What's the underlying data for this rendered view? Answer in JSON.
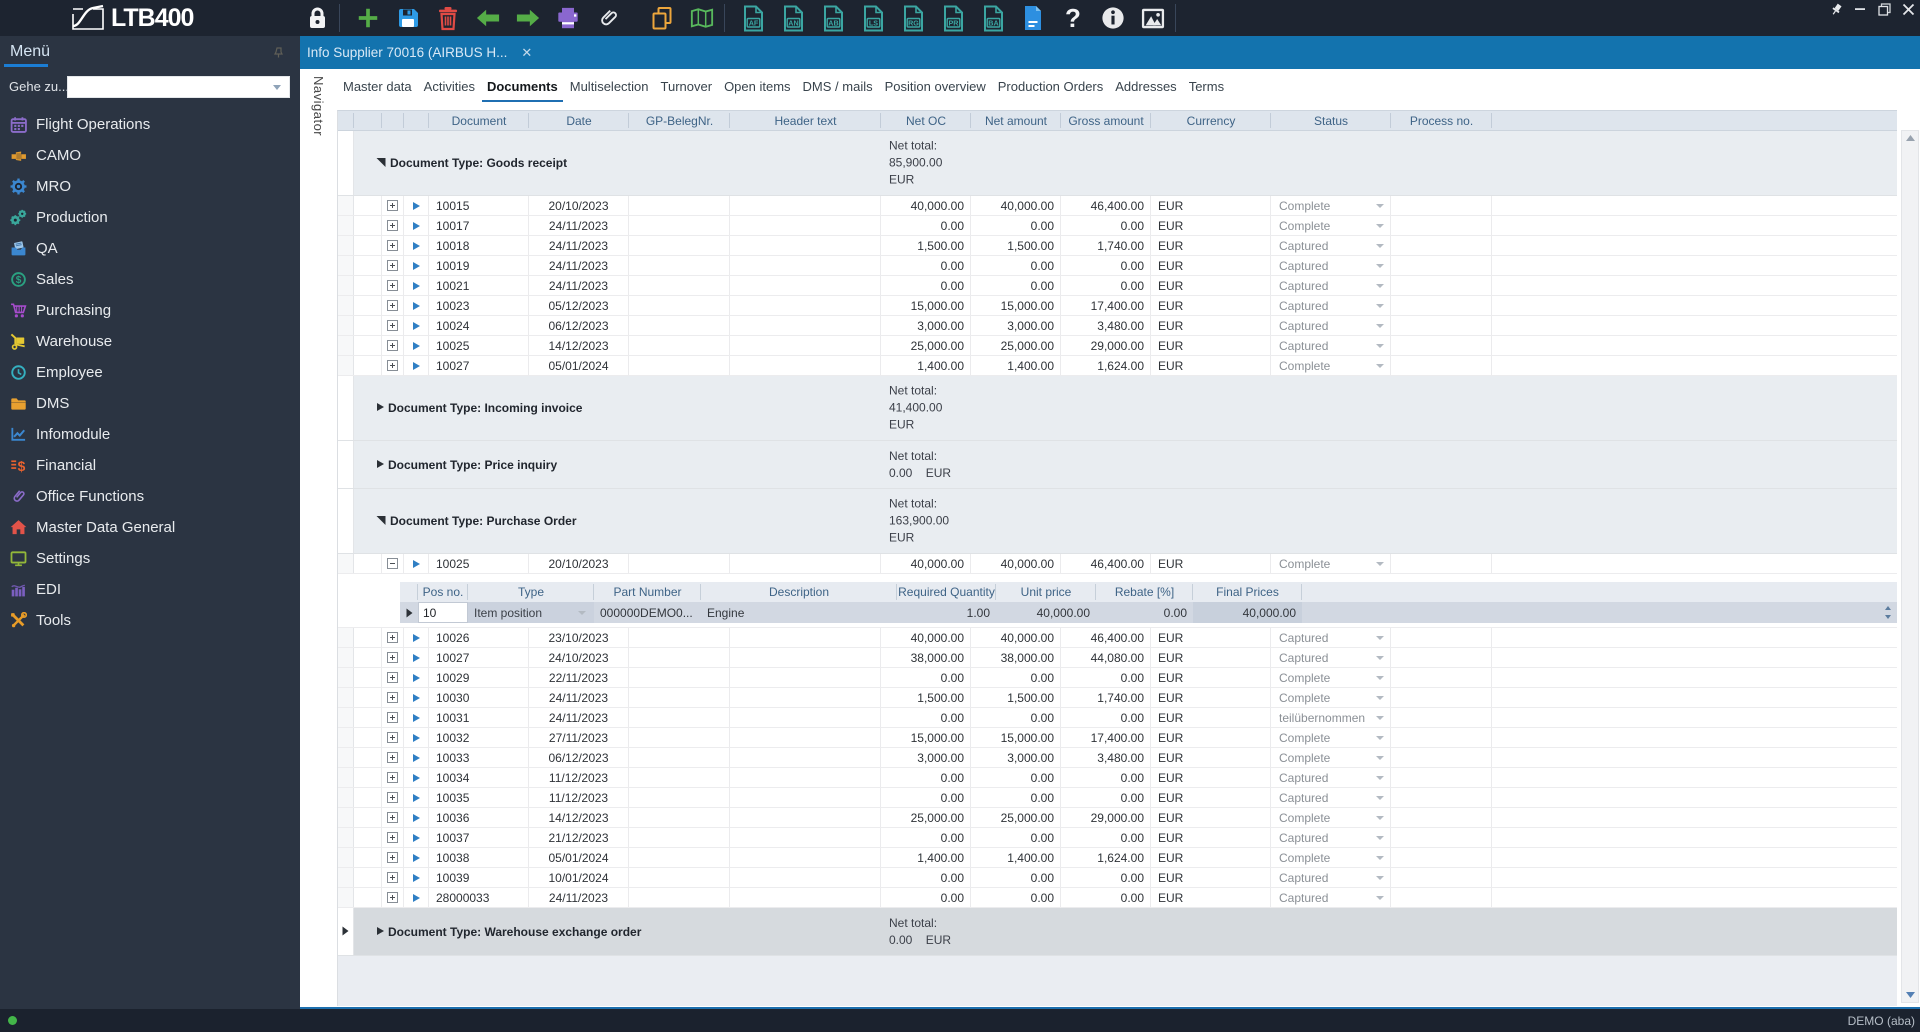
{
  "app": {
    "logo": "LTB400"
  },
  "topbar": {
    "tools": [
      {
        "name": "lock",
        "color": "#f2f3f5"
      },
      {
        "name": "separator"
      },
      {
        "name": "new",
        "color": "#55ad47"
      },
      {
        "name": "save",
        "color": "#2e9be6"
      },
      {
        "name": "delete",
        "color": "#e04b45"
      },
      {
        "name": "back",
        "color": "#55ad47"
      },
      {
        "name": "forward",
        "color": "#55ad47"
      },
      {
        "name": "print",
        "color": "#8a67cf"
      },
      {
        "name": "attachment",
        "color": "#e8eaed"
      },
      {
        "name": "copy",
        "color": "#edA63c"
      },
      {
        "name": "map",
        "color": "#58b85c"
      },
      {
        "name": "separator"
      },
      {
        "name": "doc-letter",
        "letters": "AF",
        "color": "#3ba6a2"
      },
      {
        "name": "doc-letter",
        "letters": "AN",
        "color": "#3ba6a2"
      },
      {
        "name": "doc-letter",
        "letters": "AB",
        "color": "#3ba6a2"
      },
      {
        "name": "doc-letter",
        "letters": "LS",
        "color": "#3ba6a2"
      },
      {
        "name": "doc-letter",
        "letters": "RG",
        "color": "#3ba6a2"
      },
      {
        "name": "doc-letter",
        "letters": "PR",
        "color": "#3ba6a2"
      },
      {
        "name": "doc-letter",
        "letters": "BA",
        "color": "#3ba6a2"
      },
      {
        "name": "doc-blue",
        "color": "#2d8fe0"
      },
      {
        "name": "help",
        "color": "#f2f3f5"
      },
      {
        "name": "info",
        "color": "#e9eaec"
      },
      {
        "name": "image",
        "color": "#e9eaec"
      },
      {
        "name": "separator"
      }
    ],
    "window_buttons": [
      "pin",
      "minimize",
      "restore",
      "close"
    ]
  },
  "sidebar": {
    "title": "Menü",
    "goto_label": "Gehe zu...",
    "goto_value": "",
    "items": [
      {
        "label": "Flight Operations",
        "icon": "calendar",
        "color": "#8b6cc9"
      },
      {
        "label": "CAMO",
        "icon": "camo-tool",
        "color": "#e09a2f"
      },
      {
        "label": "MRO",
        "icon": "gear",
        "color": "#3b87d0"
      },
      {
        "label": "Production",
        "icon": "gears",
        "color": "#3aa79b"
      },
      {
        "label": "QA",
        "icon": "archive",
        "color": "#3b87d0"
      },
      {
        "label": "Sales",
        "icon": "dollar-circle",
        "color": "#2ba181"
      },
      {
        "label": "Purchasing",
        "icon": "cart",
        "color": "#a64ccc"
      },
      {
        "label": "Warehouse",
        "icon": "handtruck",
        "color": "#e5c832"
      },
      {
        "label": "Employee",
        "icon": "clock",
        "color": "#35b0c0"
      },
      {
        "label": "DMS",
        "icon": "folder",
        "color": "#e8a030"
      },
      {
        "label": "Infomodule",
        "icon": "chart-line",
        "color": "#3b87d0"
      },
      {
        "label": "Financial",
        "icon": "finance",
        "color": "#e8622f"
      },
      {
        "label": "Office Functions",
        "icon": "paperclip",
        "color": "#8b6cc9"
      },
      {
        "label": "Master Data General",
        "icon": "house",
        "color": "#e25349"
      },
      {
        "label": "Settings",
        "icon": "monitor",
        "color": "#92b73a"
      },
      {
        "label": "EDI",
        "icon": "chart-bars",
        "color": "#7b5fc0"
      },
      {
        "label": "Tools",
        "icon": "tools",
        "color": "#e89c28"
      }
    ]
  },
  "doc_tab": {
    "title": "Info Supplier 70016 (AIRBUS H...",
    "close_icon": "close"
  },
  "navigator_label": "Navigator",
  "page_tabs": {
    "selected": "Documents",
    "items": [
      "Master data",
      "Activities",
      "Documents",
      "Multiselection",
      "Turnover",
      "Open items",
      "DMS / mails",
      "Position overview",
      "Production Orders",
      "Addresses",
      "Terms"
    ]
  },
  "grid": {
    "columns": [
      "Document",
      "Date",
      "GP-BelegNr.",
      "Header text",
      "Net OC",
      "Net amount",
      "Gross amount",
      "Currency",
      "Status",
      "Process no."
    ],
    "groups": [
      {
        "label": "Document Type: Goods receipt",
        "expanded": true,
        "selected": false,
        "net_total_lines": [
          "Net total:",
          "85,900.00",
          "EUR"
        ],
        "rows": [
          {
            "document": "10015",
            "date": "20/10/2023",
            "gp_beleg": "",
            "header_text": "",
            "net_oc": "40,000.00",
            "net_amount": "40,000.00",
            "gross_amount": "46,400.00",
            "currency": "EUR",
            "status": "Complete",
            "process_no": ""
          },
          {
            "document": "10017",
            "date": "24/11/2023",
            "gp_beleg": "",
            "header_text": "",
            "net_oc": "0.00",
            "net_amount": "0.00",
            "gross_amount": "0.00",
            "currency": "EUR",
            "status": "Complete",
            "process_no": ""
          },
          {
            "document": "10018",
            "date": "24/11/2023",
            "gp_beleg": "",
            "header_text": "",
            "net_oc": "1,500.00",
            "net_amount": "1,500.00",
            "gross_amount": "1,740.00",
            "currency": "EUR",
            "status": "Captured",
            "process_no": ""
          },
          {
            "document": "10019",
            "date": "24/11/2023",
            "gp_beleg": "",
            "header_text": "",
            "net_oc": "0.00",
            "net_amount": "0.00",
            "gross_amount": "0.00",
            "currency": "EUR",
            "status": "Captured",
            "process_no": ""
          },
          {
            "document": "10021",
            "date": "24/11/2023",
            "gp_beleg": "",
            "header_text": "",
            "net_oc": "0.00",
            "net_amount": "0.00",
            "gross_amount": "0.00",
            "currency": "EUR",
            "status": "Captured",
            "process_no": ""
          },
          {
            "document": "10023",
            "date": "05/12/2023",
            "gp_beleg": "",
            "header_text": "",
            "net_oc": "15,000.00",
            "net_amount": "15,000.00",
            "gross_amount": "17,400.00",
            "currency": "EUR",
            "status": "Captured",
            "process_no": ""
          },
          {
            "document": "10024",
            "date": "06/12/2023",
            "gp_beleg": "",
            "header_text": "",
            "net_oc": "3,000.00",
            "net_amount": "3,000.00",
            "gross_amount": "3,480.00",
            "currency": "EUR",
            "status": "Captured",
            "process_no": ""
          },
          {
            "document": "10025",
            "date": "14/12/2023",
            "gp_beleg": "",
            "header_text": "",
            "net_oc": "25,000.00",
            "net_amount": "25,000.00",
            "gross_amount": "29,000.00",
            "currency": "EUR",
            "status": "Captured",
            "process_no": ""
          },
          {
            "document": "10027",
            "date": "05/01/2024",
            "gp_beleg": "",
            "header_text": "",
            "net_oc": "1,400.00",
            "net_amount": "1,400.00",
            "gross_amount": "1,624.00",
            "currency": "EUR",
            "status": "Complete",
            "process_no": ""
          }
        ]
      },
      {
        "label": "Document Type: Incoming invoice",
        "expanded": false,
        "selected": false,
        "net_total_lines": [
          "Net total:",
          "41,400.00",
          "EUR"
        ],
        "rows": []
      },
      {
        "label": "Document Type: Price inquiry",
        "expanded": false,
        "selected": false,
        "net_total_lines": [
          "Net total:",
          "0.00    EUR"
        ],
        "rows": []
      },
      {
        "label": "Document Type: Purchase Order",
        "expanded": true,
        "selected": false,
        "net_total_lines": [
          "Net total:",
          "163,900.00",
          "EUR"
        ],
        "rows": [
          {
            "document": "10025",
            "date": "20/10/2023",
            "gp_beleg": "",
            "header_text": "",
            "net_oc": "40,000.00",
            "net_amount": "40,000.00",
            "gross_amount": "46,400.00",
            "currency": "EUR",
            "status": "Complete",
            "process_no": "",
            "expanded": true,
            "detail": true
          },
          {
            "document": "10026",
            "date": "23/10/2023",
            "gp_beleg": "",
            "header_text": "",
            "net_oc": "40,000.00",
            "net_amount": "40,000.00",
            "gross_amount": "46,400.00",
            "currency": "EUR",
            "status": "Captured",
            "process_no": ""
          },
          {
            "document": "10027",
            "date": "24/10/2023",
            "gp_beleg": "",
            "header_text": "",
            "net_oc": "38,000.00",
            "net_amount": "38,000.00",
            "gross_amount": "44,080.00",
            "currency": "EUR",
            "status": "Captured",
            "process_no": ""
          },
          {
            "document": "10029",
            "date": "22/11/2023",
            "gp_beleg": "",
            "header_text": "",
            "net_oc": "0.00",
            "net_amount": "0.00",
            "gross_amount": "0.00",
            "currency": "EUR",
            "status": "Complete",
            "process_no": ""
          },
          {
            "document": "10030",
            "date": "24/11/2023",
            "gp_beleg": "",
            "header_text": "",
            "net_oc": "1,500.00",
            "net_amount": "1,500.00",
            "gross_amount": "1,740.00",
            "currency": "EUR",
            "status": "Complete",
            "process_no": ""
          },
          {
            "document": "10031",
            "date": "24/11/2023",
            "gp_beleg": "",
            "header_text": "",
            "net_oc": "0.00",
            "net_amount": "0.00",
            "gross_amount": "0.00",
            "currency": "EUR",
            "status": "teilübernommen",
            "process_no": ""
          },
          {
            "document": "10032",
            "date": "27/11/2023",
            "gp_beleg": "",
            "header_text": "",
            "net_oc": "15,000.00",
            "net_amount": "15,000.00",
            "gross_amount": "17,400.00",
            "currency": "EUR",
            "status": "Complete",
            "process_no": ""
          },
          {
            "document": "10033",
            "date": "06/12/2023",
            "gp_beleg": "",
            "header_text": "",
            "net_oc": "3,000.00",
            "net_amount": "3,000.00",
            "gross_amount": "3,480.00",
            "currency": "EUR",
            "status": "Complete",
            "process_no": ""
          },
          {
            "document": "10034",
            "date": "11/12/2023",
            "gp_beleg": "",
            "header_text": "",
            "net_oc": "0.00",
            "net_amount": "0.00",
            "gross_amount": "0.00",
            "currency": "EUR",
            "status": "Captured",
            "process_no": ""
          },
          {
            "document": "10035",
            "date": "11/12/2023",
            "gp_beleg": "",
            "header_text": "",
            "net_oc": "0.00",
            "net_amount": "0.00",
            "gross_amount": "0.00",
            "currency": "EUR",
            "status": "Captured",
            "process_no": ""
          },
          {
            "document": "10036",
            "date": "14/12/2023",
            "gp_beleg": "",
            "header_text": "",
            "net_oc": "25,000.00",
            "net_amount": "25,000.00",
            "gross_amount": "29,000.00",
            "currency": "EUR",
            "status": "Complete",
            "process_no": ""
          },
          {
            "document": "10037",
            "date": "21/12/2023",
            "gp_beleg": "",
            "header_text": "",
            "net_oc": "0.00",
            "net_amount": "0.00",
            "gross_amount": "0.00",
            "currency": "EUR",
            "status": "Captured",
            "process_no": ""
          },
          {
            "document": "10038",
            "date": "05/01/2024",
            "gp_beleg": "",
            "header_text": "",
            "net_oc": "1,400.00",
            "net_amount": "1,400.00",
            "gross_amount": "1,624.00",
            "currency": "EUR",
            "status": "Complete",
            "process_no": ""
          },
          {
            "document": "10039",
            "date": "10/01/2024",
            "gp_beleg": "",
            "header_text": "",
            "net_oc": "0.00",
            "net_amount": "0.00",
            "gross_amount": "0.00",
            "currency": "EUR",
            "status": "Captured",
            "process_no": ""
          },
          {
            "document": "28000033",
            "date": "24/11/2023",
            "gp_beleg": "",
            "header_text": "",
            "net_oc": "0.00",
            "net_amount": "0.00",
            "gross_amount": "0.00",
            "currency": "EUR",
            "status": "Captured",
            "process_no": ""
          }
        ]
      },
      {
        "label": "Document Type: Warehouse exchange order",
        "expanded": false,
        "selected": true,
        "net_total_lines": [
          "Net total:",
          "0.00    EUR"
        ],
        "rows": []
      }
    ]
  },
  "subgrid": {
    "columns": [
      "Pos no.",
      "Type",
      "Part Number",
      "Description",
      "Required Quantity",
      "Unit price",
      "Rebate [%]",
      "Final Prices"
    ],
    "row": {
      "pos_no": "10",
      "type": "Item position",
      "part_number": "000000DEMO0...",
      "description": "Engine",
      "required_quantity": "1.00",
      "unit_price": "40,000.00",
      "rebate": "0.00",
      "final_prices": "40,000.00"
    }
  },
  "statusbar": {
    "user": "DEMO (aba)"
  }
}
